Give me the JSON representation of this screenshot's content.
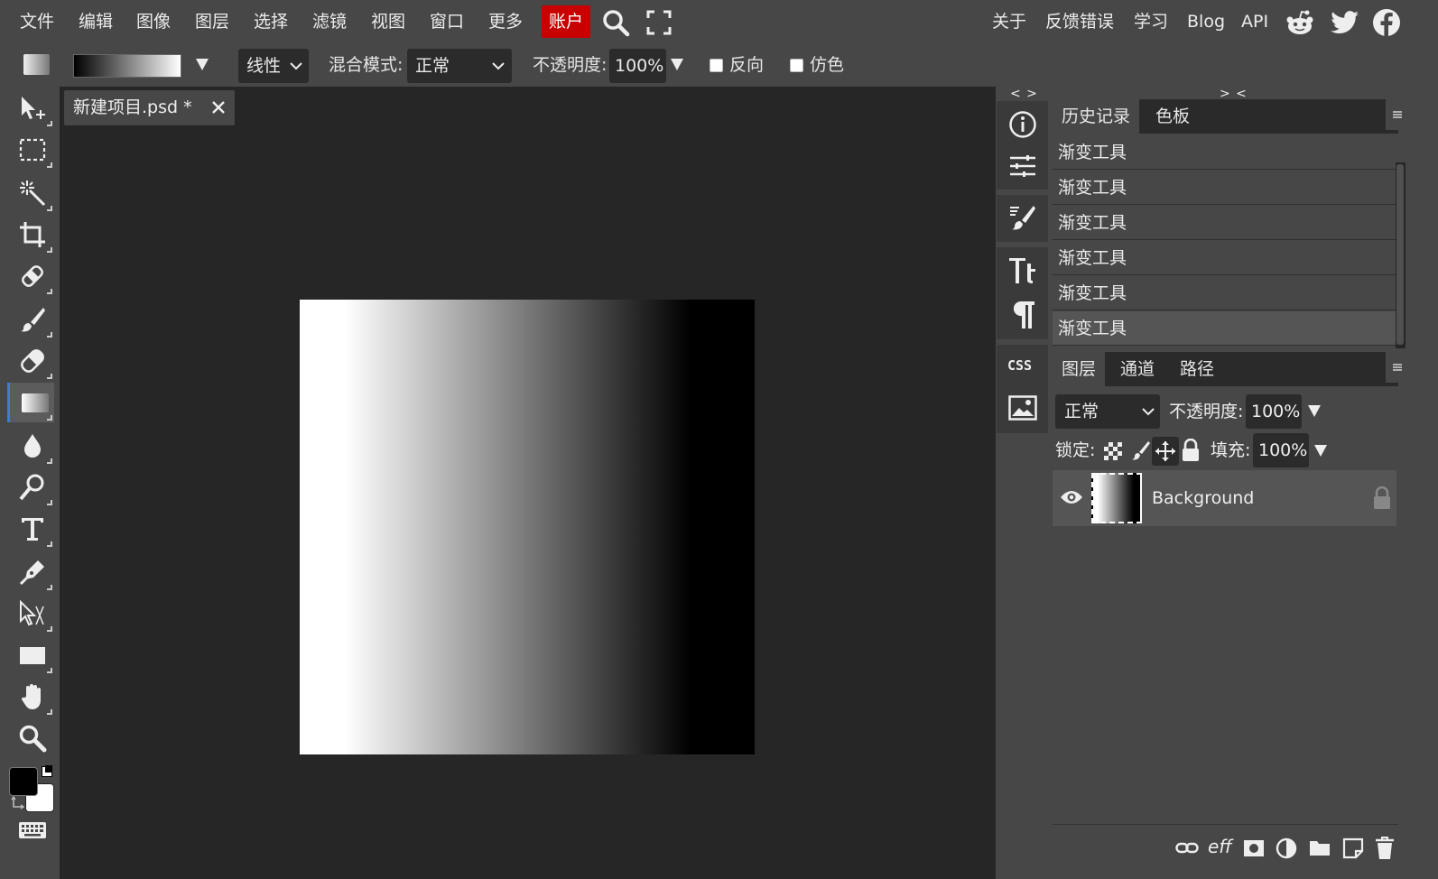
{
  "menu": {
    "items": [
      "文件",
      "编辑",
      "图像",
      "图层",
      "选择",
      "滤镜",
      "视图",
      "窗口",
      "更多"
    ],
    "account": "账户",
    "right_links": [
      "关于",
      "反馈错误",
      "学习",
      "Blog",
      "API"
    ],
    "icons": [
      "search-icon",
      "fullscreen-icon",
      "reddit-icon",
      "twitter-icon",
      "facebook-icon"
    ]
  },
  "options": {
    "gradient_type": "线性",
    "blend_label": "混合模式:",
    "blend_value": "正常",
    "opacity_label": "不透明度:",
    "opacity_value": "100%",
    "reverse_label": "反向",
    "dither_label": "仿色"
  },
  "toolbar": {
    "tools": [
      "move-tool-icon",
      "marquee-tool-icon",
      "magic-wand-icon",
      "crop-icon",
      "healing-icon",
      "brush-icon",
      "eraser-icon",
      "gradient-icon",
      "blur-icon",
      "dodge-icon",
      "type-icon",
      "pen-icon",
      "path-select-icon",
      "rectangle-icon",
      "hand-icon",
      "zoom-icon"
    ],
    "active_tool": "gradient-icon",
    "foreground_color": "#000000",
    "background_color": "#ffffff"
  },
  "document": {
    "tab_title": "新建项目.psd *"
  },
  "mini_panels": {
    "arrows_left": "< >",
    "arrows_right": "> <",
    "css_label": "CSS"
  },
  "history": {
    "tabs": [
      "历史记录",
      "色板"
    ],
    "items": [
      "渐变工具",
      "渐变工具",
      "渐变工具",
      "渐变工具",
      "渐变工具",
      "渐变工具"
    ]
  },
  "layers": {
    "tabs": [
      "图层",
      "通道",
      "路径"
    ],
    "blend_value": "正常",
    "opacity_label": "不透明度:",
    "opacity_value": "100%",
    "lock_label": "锁定:",
    "fill_label": "填充:",
    "fill_value": "100%",
    "items": [
      {
        "name": "Background",
        "visible": true,
        "locked": true
      }
    ],
    "footer_icons": [
      "link-icon",
      "effects-icon",
      "mask-icon",
      "adjustment-icon",
      "folder-icon",
      "new-layer-icon",
      "trash-icon"
    ],
    "footer_eff": "eff"
  },
  "colors": {
    "accent": "#3d7bd6",
    "account_bg": "#c90000",
    "panel_bg": "#474747",
    "workspace_bg": "#262626"
  }
}
